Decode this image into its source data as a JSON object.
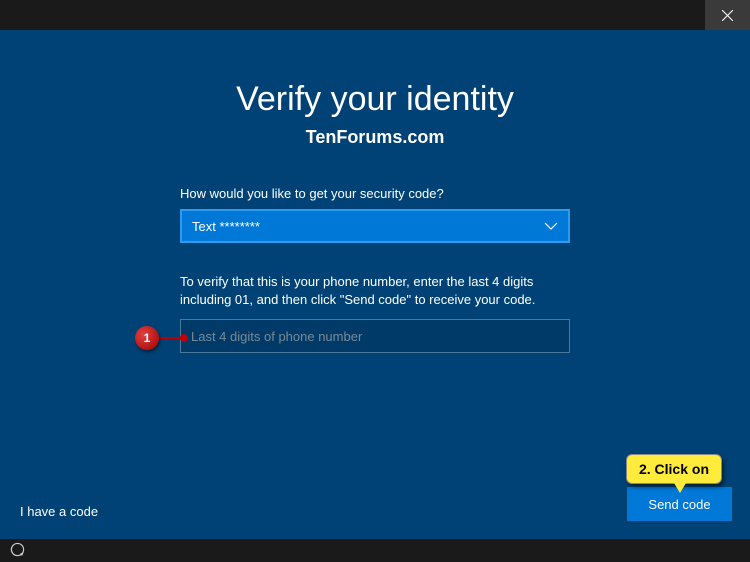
{
  "heading": "Verify your identity",
  "watermark": "TenForums.com",
  "prompt_label": "How would you like to get your security code?",
  "dropdown": {
    "selected": "Text ********"
  },
  "instruction": "To verify that this is your phone number, enter the last 4 digits including 01, and then click \"Send code\" to receive your code.",
  "input": {
    "placeholder": "Last 4 digits of phone number",
    "value": ""
  },
  "have_code_link": "I have a code",
  "send_button": "Send code",
  "annotations": {
    "step1": "1",
    "step2": "2. Click on"
  }
}
